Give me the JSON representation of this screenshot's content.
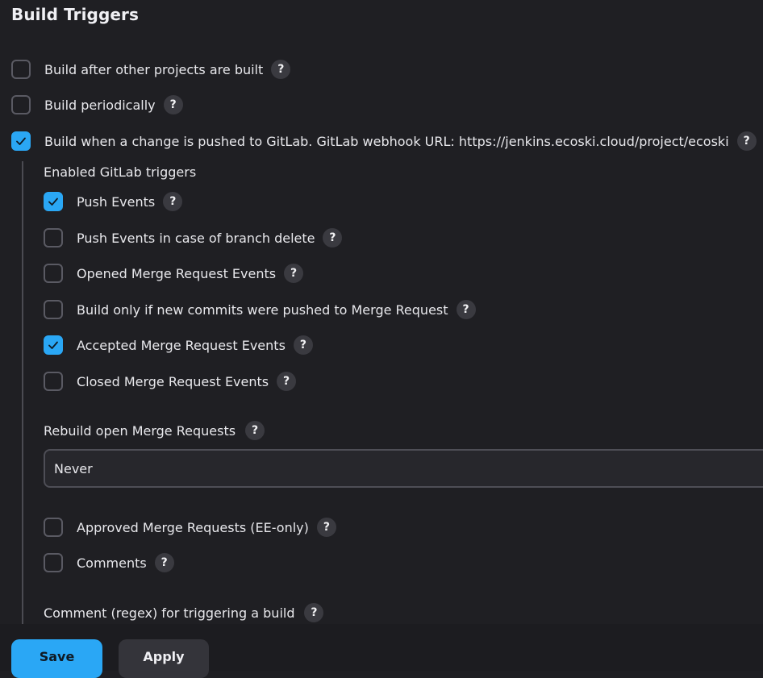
{
  "section": {
    "title": "Build Triggers"
  },
  "triggers": [
    {
      "label": "Build after other projects are built",
      "checked": false
    },
    {
      "label": "Build periodically",
      "checked": false
    },
    {
      "label": "Build when a change is pushed to GitLab. GitLab webhook URL: https://jenkins.ecoski.cloud/project/ecoski",
      "checked": true
    }
  ],
  "gitlab": {
    "enabled_label": "Enabled GitLab triggers",
    "events": [
      {
        "label": "Push Events",
        "checked": true
      },
      {
        "label": "Push Events in case of branch delete",
        "checked": false
      },
      {
        "label": "Opened Merge Request Events",
        "checked": false
      },
      {
        "label": "Build only if new commits were pushed to Merge Request",
        "checked": false
      },
      {
        "label": "Accepted Merge Request Events",
        "checked": true
      },
      {
        "label": "Closed Merge Request Events",
        "checked": false
      }
    ],
    "rebuild_label": "Rebuild open Merge Requests",
    "rebuild_value": "Never",
    "approved_label": "Approved Merge Requests (EE-only)",
    "approved_checked": false,
    "comments_label": "Comments",
    "comments_checked": false,
    "comment_regex_label": "Comment (regex) for triggering a build"
  },
  "help_glyph": "?",
  "buttons": {
    "save": "Save",
    "apply": "Apply"
  },
  "colors": {
    "accent": "#2aa7f5",
    "background": "#1f1f23"
  }
}
